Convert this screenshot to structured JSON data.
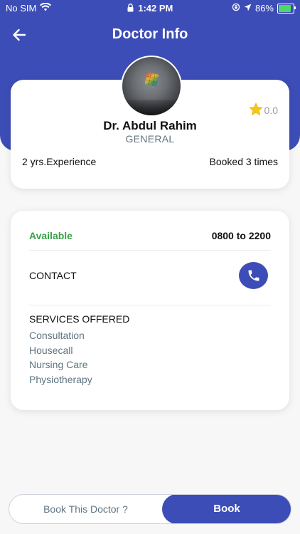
{
  "status_bar": {
    "carrier": "No SIM",
    "time": "1:42 PM",
    "battery": "86%",
    "battery_level": 0.86,
    "icons": [
      "wifi-icon",
      "lock-icon",
      "orientation-lock-icon",
      "location-arrow-icon",
      "battery-charging-icon"
    ]
  },
  "nav": {
    "title": "Doctor Info",
    "back_icon": "back-arrow-icon"
  },
  "profile": {
    "name": "Dr. Abdul Rahim",
    "department": "GENERAL",
    "rating": "0.0",
    "experience": "2 yrs.Experience",
    "booked": "Booked 3 times"
  },
  "details": {
    "availability": "Available",
    "hours": "0800 to 2200",
    "contact_label": "CONTACT",
    "services_title": "SERVICES OFFERED",
    "services": [
      "Consultation",
      "Housecall",
      "Nursing Care",
      "Physiotherapy"
    ]
  },
  "actions": {
    "book_prompt": "Book This Doctor ?",
    "book_label": "Book"
  },
  "colors": {
    "primary": "#3d4db7",
    "available": "#3aa04a",
    "muted_text": "#5f7480",
    "star": "#f5c518"
  }
}
